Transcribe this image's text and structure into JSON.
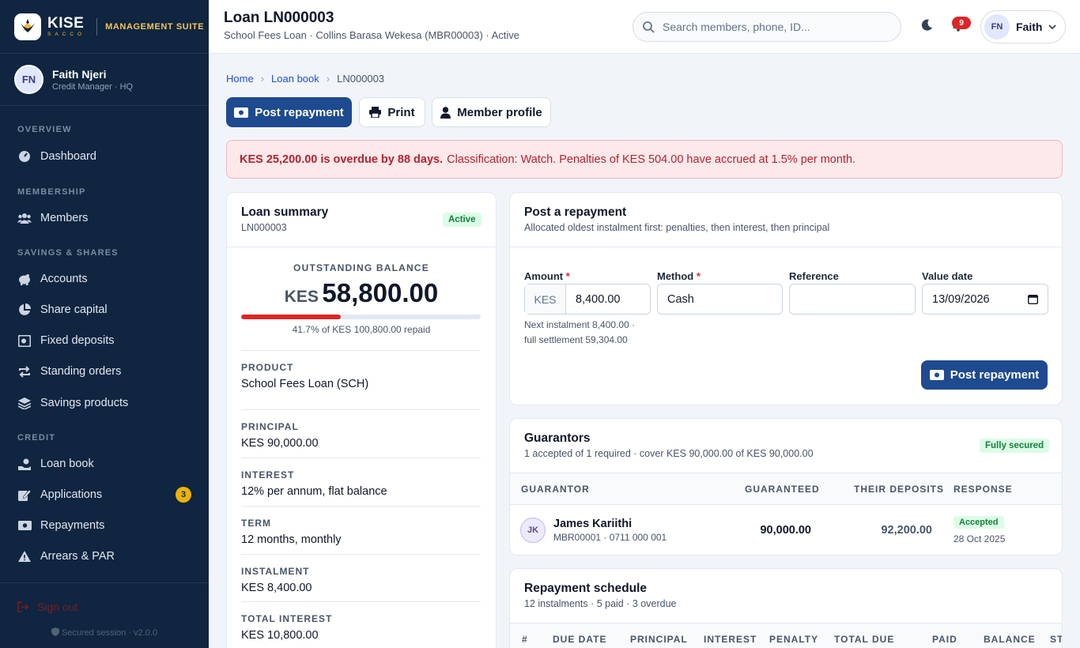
{
  "brand": {
    "name": "KISE",
    "tagline": "SACCO",
    "suite": "MANAGEMENT SUITE"
  },
  "sidebar_user": {
    "initials": "FN",
    "name": "Faith Njeri",
    "role": "Credit Manager · HQ"
  },
  "nav": {
    "overview": "OVERVIEW",
    "membership": "MEMBERSHIP",
    "savings": "SAVINGS & SHARES",
    "credit": "CREDIT",
    "items": {
      "dashboard": "Dashboard",
      "members": "Members",
      "accounts": "Accounts",
      "share_capital": "Share capital",
      "fixed_deposits": "Fixed deposits",
      "standing_orders": "Standing orders",
      "savings_products": "Savings products",
      "loan_book": "Loan book",
      "applications": "Applications",
      "applications_badge": "3",
      "repayments": "Repayments",
      "arrears": "Arrears & PAR"
    },
    "sign_out": "Sign out",
    "secured": "Secured session · v2.0.0"
  },
  "header": {
    "title": "Loan LN000003",
    "subtitle": "School Fees Loan · Collins Barasa Wekesa (MBR00003) · Active",
    "search_placeholder": "Search members, phone, ID...",
    "notifications": "9",
    "user_initials": "FN",
    "user_name": "Faith"
  },
  "breadcrumb": {
    "home": "Home",
    "loan_book": "Loan book",
    "current": "LN000003"
  },
  "actions": {
    "post_repayment": "Post repayment",
    "print": "Print",
    "member_profile": "Member profile"
  },
  "alert": {
    "strong": "KES 25,200.00 is overdue by 88 days.",
    "text": "Classification: Watch. Penalties of KES 504.00 have accrued at 1.5% per month."
  },
  "summary": {
    "title": "Loan summary",
    "id": "LN000003",
    "status": "Active",
    "balance_label": "OUTSTANDING BALANCE",
    "currency": "KES",
    "balance": "58,800.00",
    "repaid_fraction": 0.417,
    "repaid_caption": "41.7% of KES 100,800.00 repaid",
    "rows": [
      {
        "label": "PRODUCT",
        "value": "School Fees Loan (SCH)"
      },
      {
        "label": "PRINCIPAL",
        "value": "KES 90,000.00"
      },
      {
        "label": "INTEREST",
        "value": "12% per annum, flat balance"
      },
      {
        "label": "TERM",
        "value": "12 months, monthly"
      },
      {
        "label": "INSTALMENT",
        "value": "KES 8,400.00"
      },
      {
        "label": "TOTAL INTEREST",
        "value": "KES 10,800.00"
      }
    ]
  },
  "repayment": {
    "title": "Post a repayment",
    "subtitle": "Allocated oldest instalment first: penalties, then interest, then principal",
    "amount_label": "Amount",
    "method_label": "Method",
    "reference_label": "Reference",
    "date_label": "Value date",
    "required": "*",
    "currency": "KES",
    "amount": "8,400.00",
    "method": "Cash",
    "reference": "",
    "value_date": "13/09/2026",
    "hint1": "Next instalment 8,400.00 ·",
    "hint2": "full settlement 59,304.00",
    "submit": "Post repayment"
  },
  "guarantors": {
    "title": "Guarantors",
    "subtitle": "1 accepted of 1 required · cover KES 90,000.00 of KES 90,000.00",
    "badge": "Fully secured",
    "columns": [
      "GUARANTOR",
      "GUARANTEED",
      "THEIR DEPOSITS",
      "RESPONSE"
    ],
    "rows": [
      {
        "initials": "JK",
        "name": "James Kariithi",
        "meta": "MBR00001 · 0711 000 001",
        "guaranteed": "90,000.00",
        "deposits": "92,200.00",
        "response": "Accepted",
        "date": "28 Oct 2025"
      }
    ]
  },
  "schedule": {
    "title": "Repayment schedule",
    "subtitle": "12 instalments · 5 paid · 3 overdue",
    "columns": [
      "#",
      "DUE DATE",
      "PRINCIPAL",
      "INTEREST",
      "PENALTY",
      "TOTAL DUE",
      "PAID",
      "BALANCE",
      "ST"
    ]
  }
}
